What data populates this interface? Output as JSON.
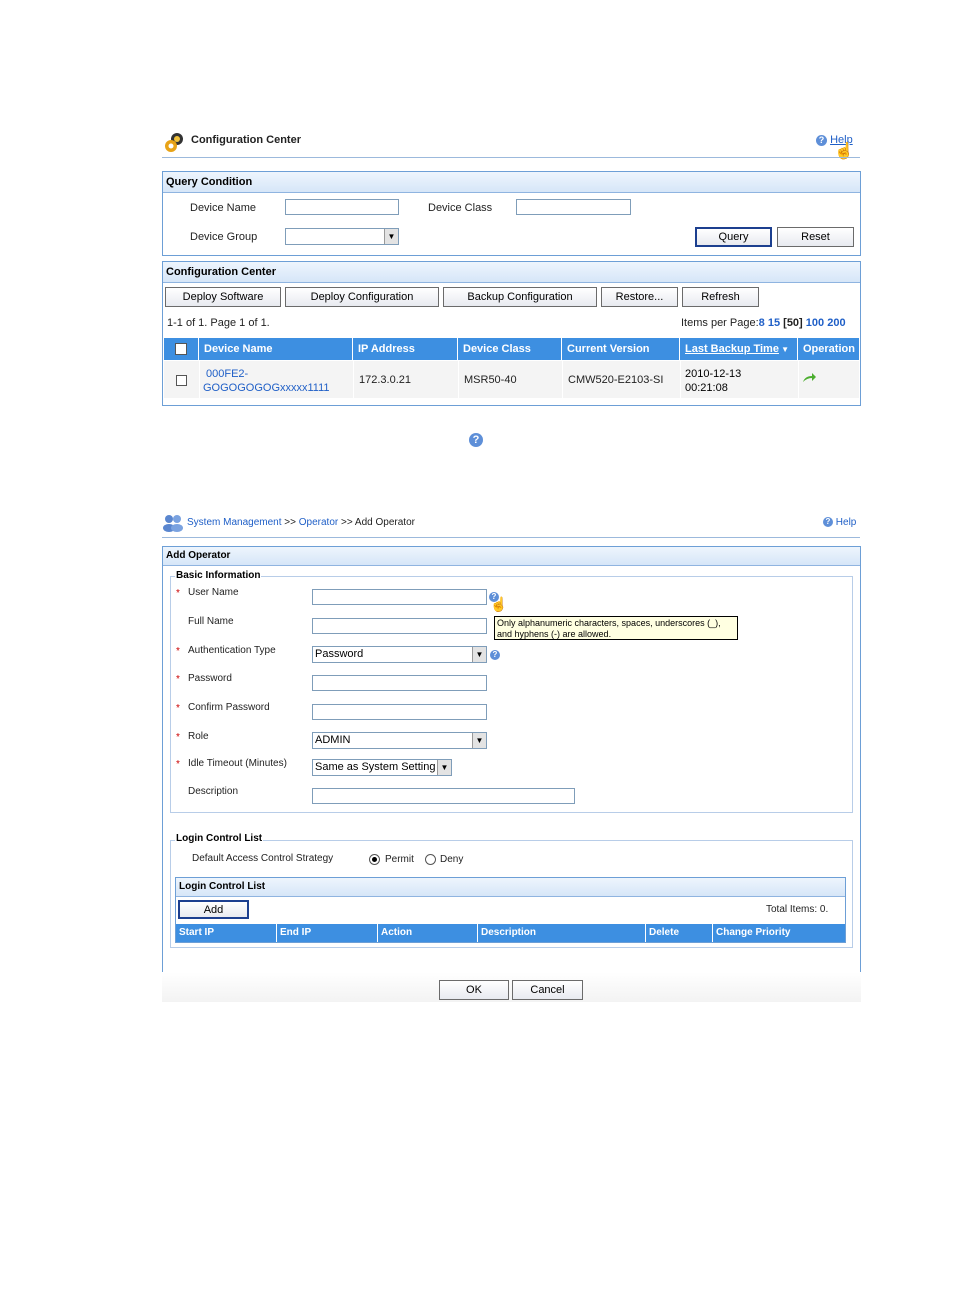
{
  "config_center": {
    "title": "Configuration Center",
    "help": "Help",
    "query": {
      "heading": "Query Condition",
      "device_name_label": "Device Name",
      "device_name_value": "",
      "device_class_label": "Device Class",
      "device_class_value": "",
      "device_group_label": "Device Group",
      "device_group_value": "",
      "query_button": "Query",
      "reset_button": "Reset"
    },
    "list": {
      "heading": "Configuration Center",
      "buttons": [
        "Deploy Software",
        "Deploy Configuration",
        "Backup Configuration",
        "Restore...",
        "Refresh"
      ],
      "paging_text": "1-1 of 1. Page 1 of 1.",
      "items_per_page_label": "Items per Page:",
      "page_sizes": [
        "8",
        "15",
        "[50]",
        "100",
        "200"
      ],
      "columns": [
        "Device Name",
        "IP Address",
        "Device Class",
        "Current Version",
        "Last Backup Time",
        "Operation"
      ],
      "rows": [
        {
          "device_name_1": "000FE2-",
          "device_name_2": "GOGOGOGOGxxxxx1111",
          "ip": "172.3.0.21",
          "device_class": "MSR50-40",
          "version": "CMW520-E2103-SI",
          "backup_1": "2010-12-13",
          "backup_2": "00:21:08"
        }
      ]
    }
  },
  "add_operator": {
    "breadcrumb": {
      "part1": "System Management",
      "sep1": ">>",
      "part2": "Operator",
      "sep2": ">>",
      "part3": "Add Operator"
    },
    "help": "Help",
    "heading": "Add Operator",
    "basic_info": {
      "legend": "Basic Information",
      "required_mark": "*",
      "user_name_label": "User Name",
      "user_name_value": "",
      "full_name_label": "Full Name",
      "full_name_value": "",
      "auth_type_label": "Authentication Type",
      "auth_type_value": "Password",
      "password_label": "Password",
      "confirm_password_label": "Confirm Password",
      "role_label": "Role",
      "role_value": "ADMIN",
      "idle_timeout_label": "Idle Timeout (Minutes)",
      "idle_timeout_value": "Same as System Setting",
      "description_label": "Description",
      "description_value": "",
      "tooltip_line1": "Only alphanumeric characters, spaces, underscores (_),",
      "tooltip_line2": "and hyphens (-) are allowed."
    },
    "login_control": {
      "legend": "Login Control List",
      "strategy_label": "Default Access Control Strategy",
      "permit_label": "Permit",
      "deny_label": "Deny",
      "selected": "Permit",
      "table_heading": "Login Control List",
      "add_button": "Add",
      "total_items": "Total Items: 0.",
      "columns": [
        "Start IP",
        "End IP",
        "Action",
        "Description",
        "Delete",
        "Change Priority"
      ]
    },
    "ok_button": "OK",
    "cancel_button": "Cancel"
  },
  "colors": {
    "grid_header": "#3d8fe1",
    "link": "#1f5fc7",
    "panel_border": "#6d9fd6"
  }
}
